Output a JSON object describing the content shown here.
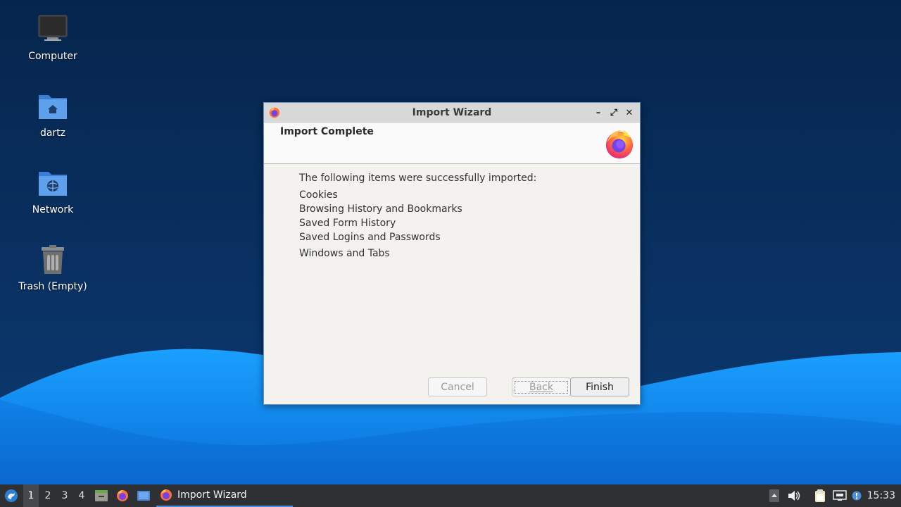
{
  "desktop": {
    "icons": [
      {
        "label": "Computer"
      },
      {
        "label": "dartz"
      },
      {
        "label": "Network"
      },
      {
        "label": "Trash (Empty)"
      }
    ]
  },
  "window": {
    "title": "Import Wizard",
    "controls": {
      "minimize": "–",
      "maximize": "⤢",
      "close": "✕"
    },
    "header": {
      "heading": "Import Complete"
    },
    "body": {
      "intro": "The following items were successfully imported:",
      "items": [
        "Cookies",
        "Browsing History and Bookmarks",
        "Saved Form History",
        "Saved Logins and Passwords",
        "Windows and Tabs"
      ]
    },
    "buttons": {
      "cancel": "Cancel",
      "back": "Back",
      "finish": "Finish"
    }
  },
  "taskbar": {
    "workspaces": [
      "1",
      "2",
      "3",
      "4"
    ],
    "active_workspace": "1",
    "task_label": "Import Wizard",
    "clock": "15:33"
  },
  "colors": {
    "wallpaper_dark": "#0b2a55",
    "wallpaper_wave": "#1b8ff0",
    "taskbar": "#2e3033",
    "accent": "#4a90d9"
  }
}
